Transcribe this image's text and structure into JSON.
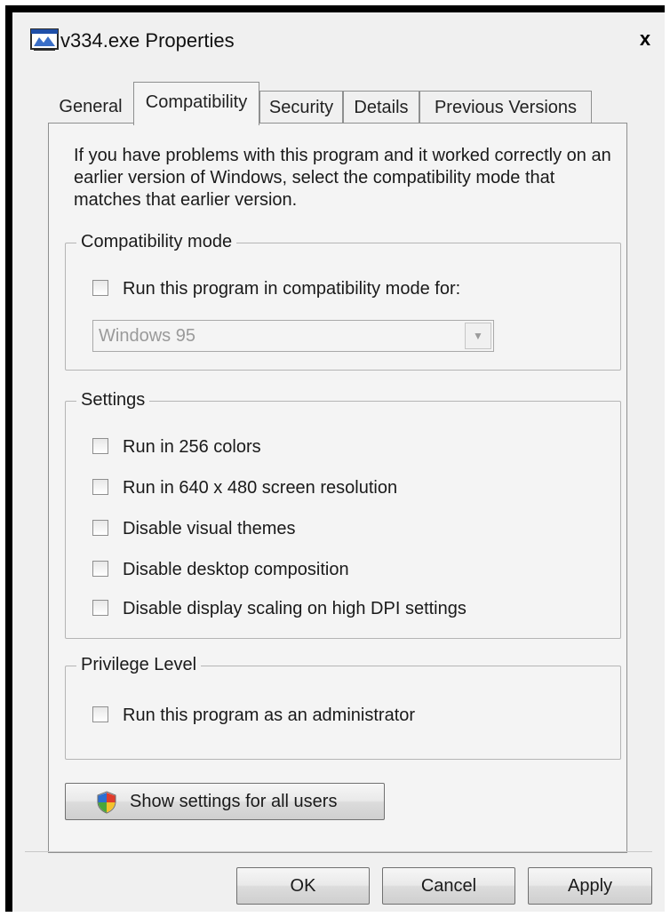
{
  "window": {
    "title": "v334.exe Properties",
    "close_label": "x"
  },
  "tabs": [
    {
      "label": "General",
      "active": false
    },
    {
      "label": "Compatibility",
      "active": true
    },
    {
      "label": "Security",
      "active": false
    },
    {
      "label": "Details",
      "active": false
    },
    {
      "label": "Previous Versions",
      "active": false
    }
  ],
  "intro_text": "If you have problems with this program and it worked correctly on an earlier version of Windows, select the compatibility mode that matches that earlier version.",
  "compatibility_mode": {
    "group_label": "Compatibility mode",
    "checkbox_label": "Run this program in compatibility mode for:",
    "checked": false,
    "combo_value": "Windows 95"
  },
  "settings": {
    "group_label": "Settings",
    "items": [
      {
        "label": "Run in 256 colors",
        "checked": false
      },
      {
        "label": "Run in 640 x 480 screen resolution",
        "checked": false
      },
      {
        "label": "Disable visual themes",
        "checked": false
      },
      {
        "label": "Disable desktop composition",
        "checked": false
      },
      {
        "label": "Disable display scaling on high DPI settings",
        "checked": false
      }
    ]
  },
  "privilege": {
    "group_label": "Privilege Level",
    "checkbox_label": "Run this program as an administrator",
    "checked": false
  },
  "buttons": {
    "show_all_users": "Show settings for all users",
    "ok": "OK",
    "cancel": "Cancel",
    "apply": "Apply"
  },
  "icons": {
    "app": "app-window-icon",
    "shield": "uac-shield-icon",
    "combo_arrow": "chevron-down-icon"
  }
}
